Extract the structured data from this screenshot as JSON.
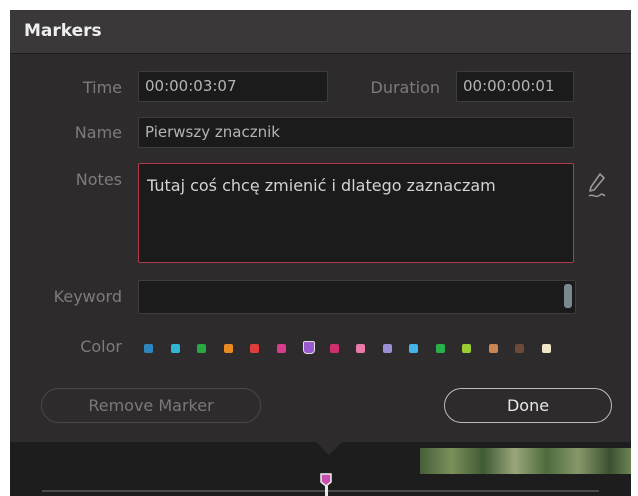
{
  "dialog": {
    "title": "Markers"
  },
  "time": {
    "label": "Time",
    "value": "00:00:03:07"
  },
  "duration": {
    "label": "Duration",
    "value": "00:00:00:01"
  },
  "name": {
    "label": "Name",
    "value": "Pierwszy znacznik"
  },
  "notes": {
    "label": "Notes",
    "value": "Tutaj coś chcę zmienić i dlatego zaznaczam",
    "edit_icon": "pen-icon"
  },
  "keyword": {
    "label": "Keyword",
    "value": ""
  },
  "color": {
    "label": "Color",
    "swatches": [
      "#2e86c1",
      "#2eb7d6",
      "#27a844",
      "#e88a1f",
      "#e23b3b",
      "#d63c8d",
      "#9b59d0",
      "#d02e6e",
      "#e87aa8",
      "#9b8fd6",
      "#45b5e8",
      "#28b04b",
      "#9acd32",
      "#c98552",
      "#6b4a3a",
      "#f2e6c9"
    ],
    "selected_index": 6
  },
  "buttons": {
    "remove": "Remove Marker",
    "done": "Done"
  }
}
